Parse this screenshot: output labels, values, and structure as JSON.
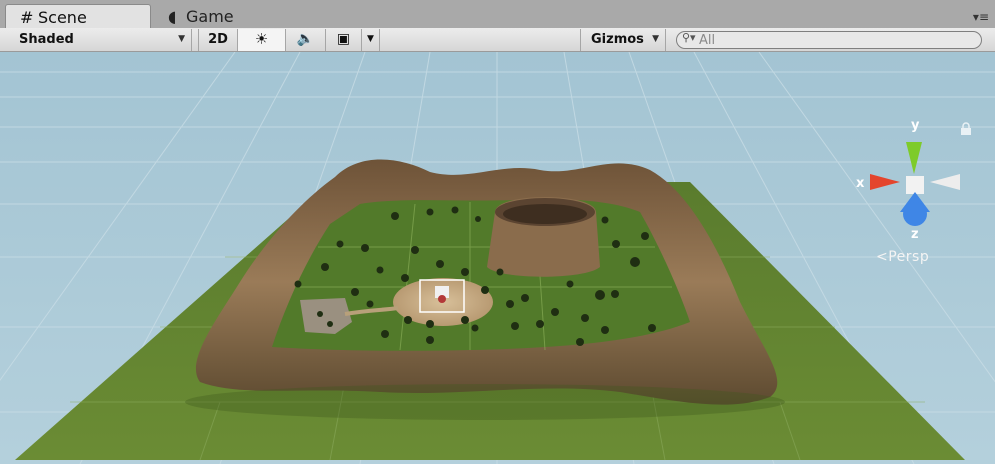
{
  "tabs": [
    {
      "label": "Scene",
      "icon": "grid-icon",
      "active": true
    },
    {
      "label": "Game",
      "icon": "pacman-icon",
      "active": false
    }
  ],
  "toolbar": {
    "shading_mode": "Shaded",
    "mode_2d": "2D",
    "gizmos_label": "Gizmos",
    "search_placeholder": "All"
  },
  "viewport": {
    "axis_labels": {
      "x": "x",
      "y": "y",
      "z": "z"
    },
    "projection_label": "Persp",
    "colors": {
      "sky": "#a9c8d6",
      "ground": "#587a2c",
      "rock": "#8a6b4a",
      "axis_x": "#e4452d",
      "axis_y": "#7ecb2a",
      "axis_z": "#3f86e6"
    }
  }
}
